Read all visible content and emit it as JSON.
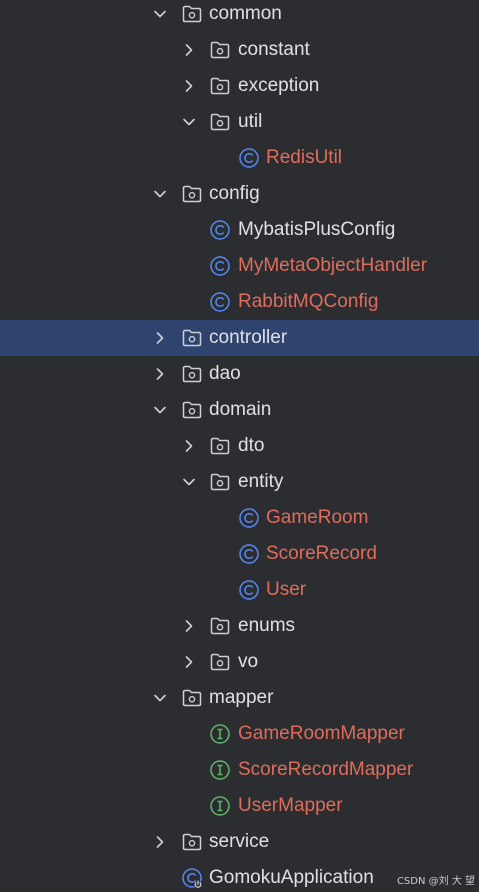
{
  "tree": {
    "items": [
      {
        "label": "common",
        "type": "folder",
        "depth": 0,
        "chevron": "expanded",
        "modified": false,
        "selected": false
      },
      {
        "label": "constant",
        "type": "folder",
        "depth": 1,
        "chevron": "collapsed",
        "modified": false,
        "selected": false
      },
      {
        "label": "exception",
        "type": "folder",
        "depth": 1,
        "chevron": "collapsed",
        "modified": false,
        "selected": false
      },
      {
        "label": "util",
        "type": "folder",
        "depth": 1,
        "chevron": "expanded",
        "modified": false,
        "selected": false
      },
      {
        "label": "RedisUtil",
        "type": "class",
        "depth": 2,
        "chevron": "none",
        "modified": true,
        "selected": false
      },
      {
        "label": "config",
        "type": "folder",
        "depth": 0,
        "chevron": "expanded",
        "modified": false,
        "selected": false
      },
      {
        "label": "MybatisPlusConfig",
        "type": "class",
        "depth": 1,
        "chevron": "none",
        "modified": false,
        "selected": false
      },
      {
        "label": "MyMetaObjectHandler",
        "type": "class",
        "depth": 1,
        "chevron": "none",
        "modified": true,
        "selected": false
      },
      {
        "label": "RabbitMQConfig",
        "type": "class",
        "depth": 1,
        "chevron": "none",
        "modified": true,
        "selected": false
      },
      {
        "label": "controller",
        "type": "folder",
        "depth": 0,
        "chevron": "collapsed",
        "modified": false,
        "selected": true
      },
      {
        "label": "dao",
        "type": "folder",
        "depth": 0,
        "chevron": "collapsed",
        "modified": false,
        "selected": false
      },
      {
        "label": "domain",
        "type": "folder",
        "depth": 0,
        "chevron": "expanded",
        "modified": false,
        "selected": false
      },
      {
        "label": "dto",
        "type": "folder",
        "depth": 1,
        "chevron": "collapsed",
        "modified": false,
        "selected": false
      },
      {
        "label": "entity",
        "type": "folder",
        "depth": 1,
        "chevron": "expanded",
        "modified": false,
        "selected": false
      },
      {
        "label": "GameRoom",
        "type": "class",
        "depth": 2,
        "chevron": "none",
        "modified": true,
        "selected": false
      },
      {
        "label": "ScoreRecord",
        "type": "class",
        "depth": 2,
        "chevron": "none",
        "modified": true,
        "selected": false
      },
      {
        "label": "User",
        "type": "class",
        "depth": 2,
        "chevron": "none",
        "modified": true,
        "selected": false
      },
      {
        "label": "enums",
        "type": "folder",
        "depth": 1,
        "chevron": "collapsed",
        "modified": false,
        "selected": false
      },
      {
        "label": "vo",
        "type": "folder",
        "depth": 1,
        "chevron": "collapsed",
        "modified": false,
        "selected": false
      },
      {
        "label": "mapper",
        "type": "folder",
        "depth": 0,
        "chevron": "expanded",
        "modified": false,
        "selected": false
      },
      {
        "label": "GameRoomMapper",
        "type": "interface",
        "depth": 1,
        "chevron": "none",
        "modified": true,
        "selected": false
      },
      {
        "label": "ScoreRecordMapper",
        "type": "interface",
        "depth": 1,
        "chevron": "none",
        "modified": true,
        "selected": false
      },
      {
        "label": "UserMapper",
        "type": "interface",
        "depth": 1,
        "chevron": "none",
        "modified": true,
        "selected": false
      },
      {
        "label": "service",
        "type": "folder",
        "depth": 0,
        "chevron": "collapsed",
        "modified": false,
        "selected": false
      },
      {
        "label": "GomokuApplication",
        "type": "spring-class",
        "depth": 0,
        "chevron": "none",
        "modified": false,
        "selected": false
      }
    ]
  },
  "watermark": "CSDN @刘 大 望",
  "colors": {
    "background": "#2b2d30",
    "selection": "#2e436e",
    "text": "#dfe1e5",
    "modified_text": "#e06c5b",
    "class_icon": "#548af7",
    "interface_icon": "#5fb865",
    "icon_outline": "#ced0d6"
  }
}
